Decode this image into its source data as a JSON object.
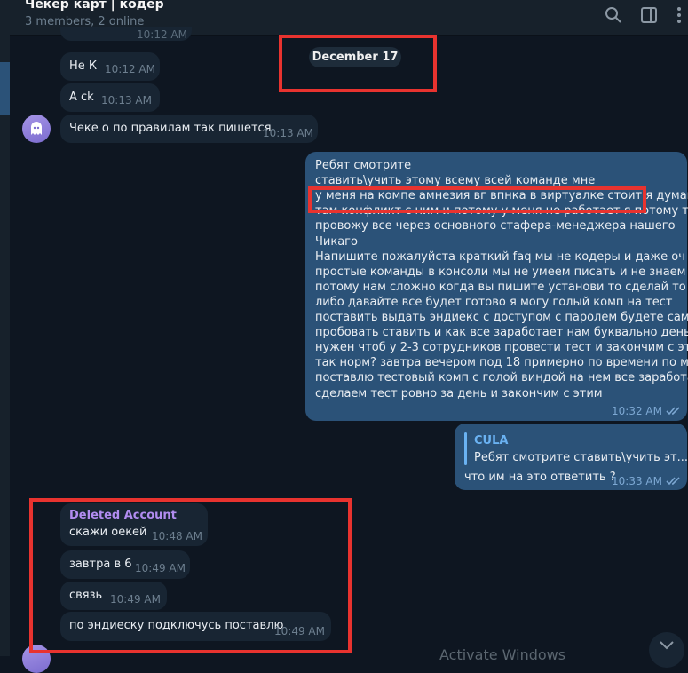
{
  "header": {
    "title": "Чекер карт | кодер",
    "subtitle": "3 members, 2 online"
  },
  "date_separator": "December 17",
  "messages_top": [
    {
      "text": "Не К",
      "time": "10:12 AM"
    },
    {
      "text": "А ck",
      "time": "10:13 AM"
    },
    {
      "text": "Чеке о по правилам так пишется",
      "time": "10:13 AM"
    }
  ],
  "partial_top_time": "10:12 AM",
  "long_message": {
    "lines": [
      "Ребят смотрите",
      "ставить\\учить этому всему всей команде мне",
      "у меня на компе амнезия вг впнка в виртуалке стоит я думаю",
      "там конфликт с ним и потому у меня не работает я потому тесты",
      "провожу все через основного стафера-менеджера нашего",
      "Чикаго",
      "Напишите пожалуйста краткий faq мы не кодеры и даже оч",
      "простые команды в консоли мы не умеем писать и не знаем их",
      "потому нам сложно когда вы пишите установи то сделай то",
      "либо давайте все будет готово я могу голый комп на тест",
      "поставить выдать эндиекс с доступом с паролем будете сами",
      "пробовать ставить и как все заработает нам буквально день",
      "нужен чтоб у 2-3 сотрудников провести тест и закончим с этим",
      "так норм? завтра вечером под 18 примерно по времени по мск",
      "поставлю тестовый комп с голой виндой на нем все заработает",
      "сделаем тест ровно за день и закончим с этим"
    ],
    "time": "10:32 AM"
  },
  "reply_message": {
    "quote_author": "CULA",
    "quote_text": "Ребят смотрите  ставить\\учить эт...",
    "text": "что им на это ответить ?",
    "time": "10:33 AM"
  },
  "messages_bottom": {
    "author": "Deleted Account",
    "items": [
      {
        "text": "скажи оекей",
        "time": "10:48 AM"
      },
      {
        "text": "завтра в 6",
        "time": "10:49 AM"
      },
      {
        "text": "связь",
        "time": "10:49 AM"
      },
      {
        "text": "по эндиеску подключусь поставлю",
        "time": "10:49 AM"
      }
    ]
  },
  "watermark": "Activate Windows",
  "colors": {
    "background": "#0e1621",
    "incoming_bubble": "#182533",
    "outgoing_bubble": "#2b5278",
    "annotation_red": "#e8332f",
    "author_purple": "#b18cf0",
    "quote_blue": "#6ab2f2"
  },
  "icons": [
    "search-icon",
    "sidebar-toggle-icon",
    "more-vertical-icon",
    "ghost-icon",
    "double-check-icon",
    "chevron-down-icon"
  ]
}
